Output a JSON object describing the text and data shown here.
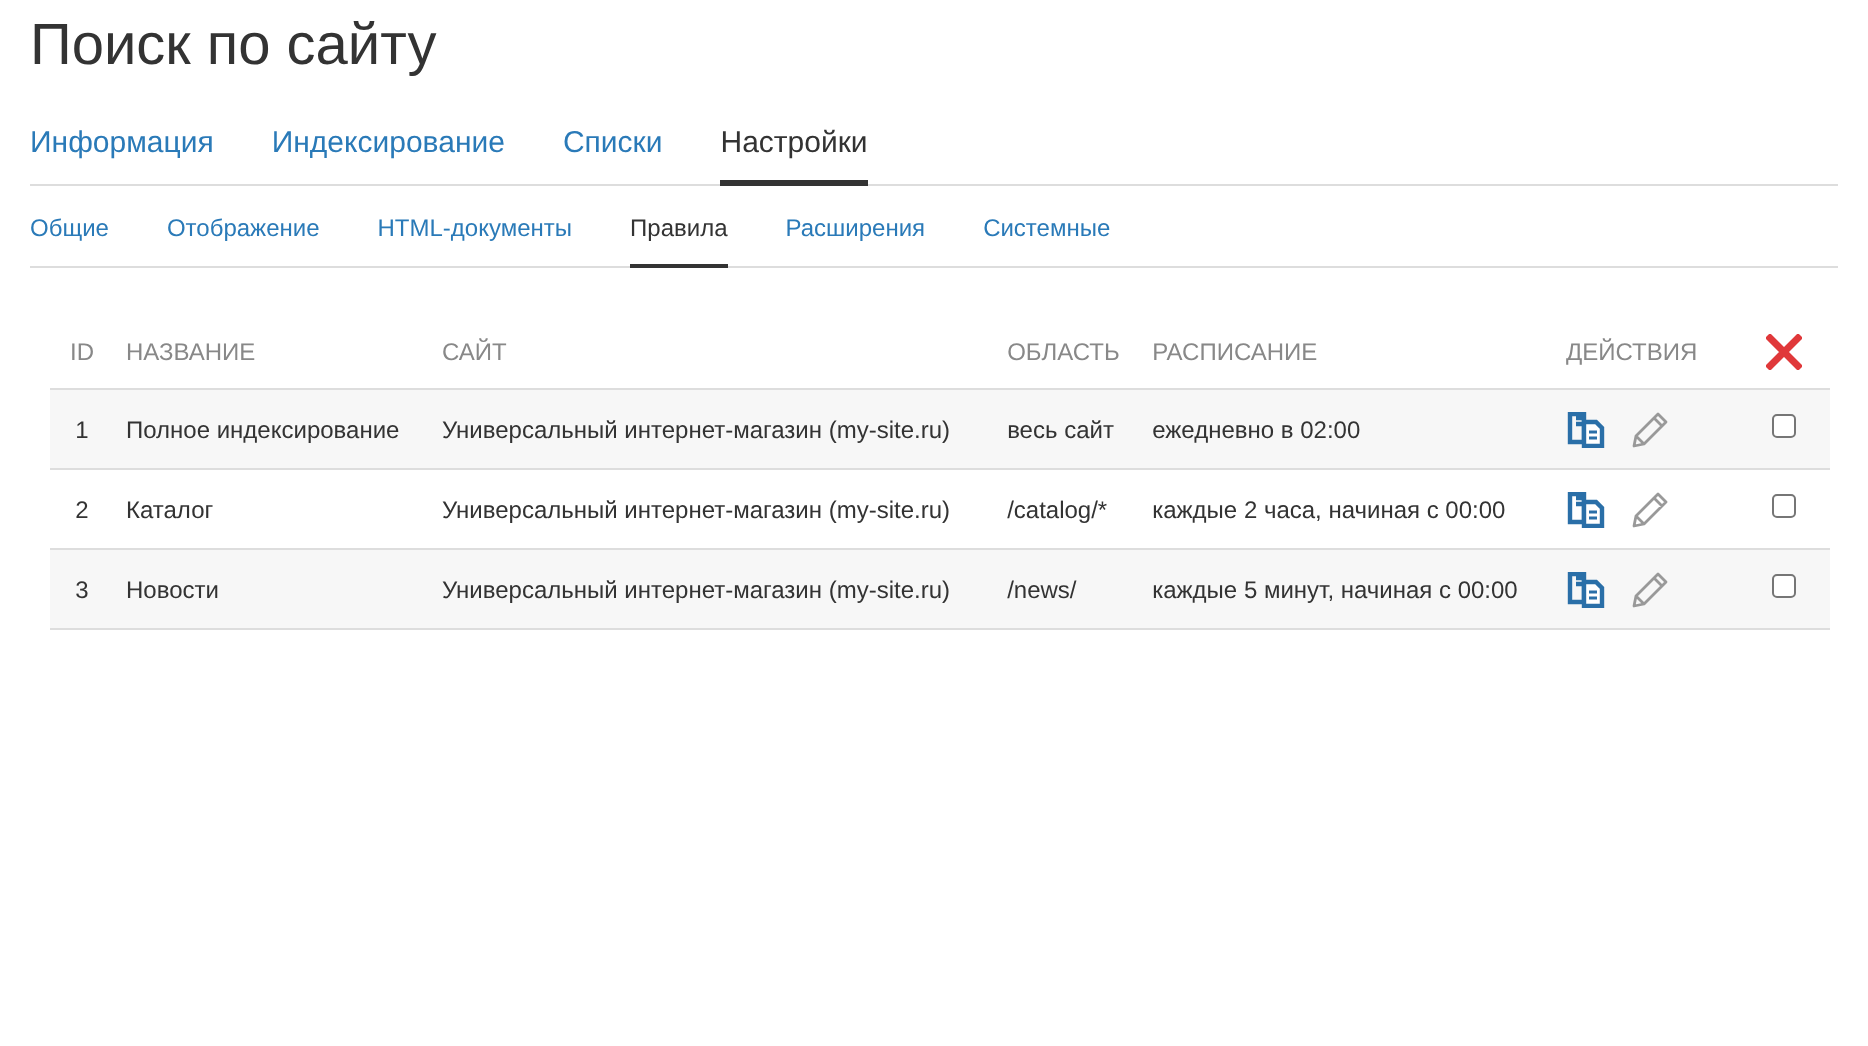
{
  "title": "Поиск по сайту",
  "tabs": [
    {
      "label": "Информация",
      "selected": false
    },
    {
      "label": "Индексирование",
      "selected": false
    },
    {
      "label": "Списки",
      "selected": false
    },
    {
      "label": "Настройки",
      "selected": true
    }
  ],
  "subtabs": [
    {
      "label": "Общие",
      "selected": false
    },
    {
      "label": "Отображение",
      "selected": false
    },
    {
      "label": "HTML-документы",
      "selected": false
    },
    {
      "label": "Правила",
      "selected": true
    },
    {
      "label": "Расширения",
      "selected": false
    },
    {
      "label": "Системные",
      "selected": false
    }
  ],
  "table": {
    "columns": [
      "ID",
      "НАЗВАНИЕ",
      "САЙТ",
      "ОБЛАСТЬ",
      "РАСПИСАНИЕ",
      "ДЕЙСТВИЯ"
    ],
    "rows": [
      {
        "id": "1",
        "name": "Полное индексирование",
        "site": "Универсальный интернет-магазин (my-site.ru)",
        "area": "весь сайт",
        "schedule": "ежедневно в 02:00",
        "checked": false
      },
      {
        "id": "2",
        "name": "Каталог",
        "site": "Универсальный интернет-магазин (my-site.ru)",
        "area": "/catalog/*",
        "schedule": "каждые 2 часа, начиная с 00:00",
        "checked": false
      },
      {
        "id": "3",
        "name": "Новости",
        "site": "Универсальный интернет-магазин (my-site.ru)",
        "area": "/news/",
        "schedule": "каждые 5 минут, начиная с 00:00",
        "checked": false
      }
    ]
  }
}
